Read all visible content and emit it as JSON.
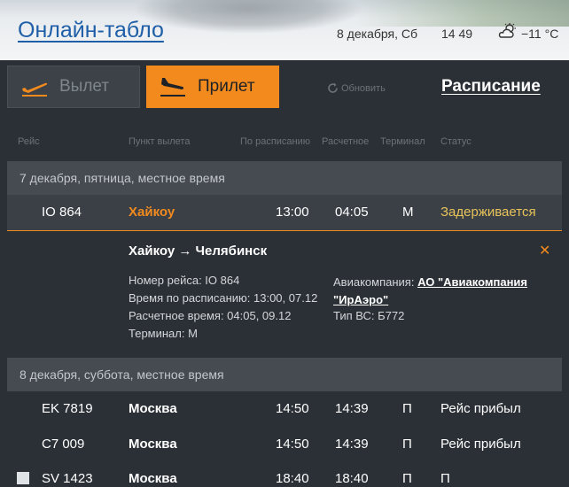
{
  "header": {
    "title": "Онлайн-табло",
    "date": "8 декабря, Сб",
    "time": "14 49",
    "weather_icon": "cloud-sun-icon",
    "temperature": "−11 °C"
  },
  "toolbar": {
    "departure_label": "Вылет",
    "arrival_label": "Прилет",
    "refresh_label": "Обновить",
    "schedule_label": "Расписание",
    "accent_color": "#f28a1e"
  },
  "columns": {
    "flight": "Рейс",
    "origin": "Пункт вылета",
    "scheduled": "По расписанию",
    "estimated": "Расчетное",
    "terminal": "Терминал",
    "status": "Статус"
  },
  "day1": {
    "label": "7 декабря, пятница, местное время",
    "flight": {
      "number": "IO 864",
      "city": "Хайкоу",
      "scheduled": "13:00",
      "estimated": "04:05",
      "terminal": "M",
      "status": "Задерживается"
    },
    "detail": {
      "route": "Хайкоу → Челябинск",
      "flight_number": "Номер рейса: IO 864",
      "scheduled": "Время по расписанию: 13:00, 07.12",
      "estimated": "Расчетное время: 04:05, 09.12",
      "terminal": "Терминал: M",
      "airline_label": "Авиакомпания:",
      "airline_name": "АО \"Авиакомпания \"ИрАэро\"",
      "aircraft": "Тип ВС: Б772",
      "close_icon": "close-icon"
    }
  },
  "day2": {
    "label": "8 декабря, суббота, местное время",
    "flights": [
      {
        "number": "EK 7819",
        "city": "Москва",
        "scheduled": "14:50",
        "estimated": "14:39",
        "terminal": "П",
        "status": "Рейс прибыл"
      },
      {
        "number": "C7 009",
        "city": "Москва",
        "scheduled": "14:50",
        "estimated": "14:39",
        "terminal": "П",
        "status": "Рейс прибыл"
      },
      {
        "number": "SV 1423",
        "city": "Москва",
        "scheduled": "18:40",
        "estimated": "18:40",
        "terminal": "П",
        "status": "П"
      }
    ]
  }
}
